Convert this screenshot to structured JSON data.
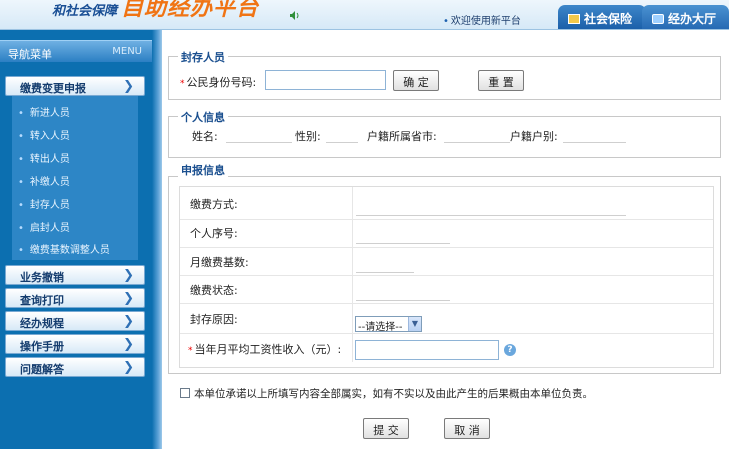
{
  "header": {
    "logo_small": "和社会保障",
    "logo_big": "自助经办平台",
    "welcome": "欢迎使用新平台",
    "tabs": [
      {
        "label": "社会保险"
      },
      {
        "label": "经办大厅"
      }
    ]
  },
  "sidebar": {
    "title": "导航菜单",
    "menu_label": "MENU",
    "sections": [
      {
        "label": "缴费变更申报"
      },
      {
        "label": "业务撤销"
      },
      {
        "label": "查询打印"
      },
      {
        "label": "经办规程"
      },
      {
        "label": "操作手册"
      },
      {
        "label": "问题解答"
      }
    ],
    "sub_items": [
      {
        "label": "新进人员"
      },
      {
        "label": "转入人员"
      },
      {
        "label": "转出人员"
      },
      {
        "label": "补缴人员"
      },
      {
        "label": "封存人员"
      },
      {
        "label": "启封人员"
      },
      {
        "label": "缴费基数调整人员"
      }
    ]
  },
  "form": {
    "section1": {
      "legend": "封存人员",
      "id_label": "公民身份号码:",
      "id_value": "",
      "confirm_label": "确 定",
      "reset_label": "重 置"
    },
    "section2": {
      "legend": "个人信息",
      "name_label": "姓名:",
      "gender_label": "性别:",
      "hukou_city_label": "户籍所属省市:",
      "hukou_type_label": "户籍户别:"
    },
    "section3": {
      "legend": "申报信息",
      "payment_method_label": "缴费方式:",
      "personal_no_label": "个人序号:",
      "monthly_base_label": "月缴费基数:",
      "payment_status_label": "缴费状态:",
      "reason_label": "封存原因:",
      "reason_select": "--请选择--",
      "income_label": "当年月平均工资性收入（元）:",
      "income_value": ""
    },
    "commitment": "本单位承诺以上所填写内容全部属实，如有不实以及由此产生的后果概由本单位负责。",
    "submit_label": "提 交",
    "cancel_label": "取 消"
  },
  "colors": {
    "sidebar_bg": "#0c6fb0",
    "accent_orange": "#f07414",
    "legend_blue": "#1a4f8f",
    "required_red": "#e00000"
  }
}
